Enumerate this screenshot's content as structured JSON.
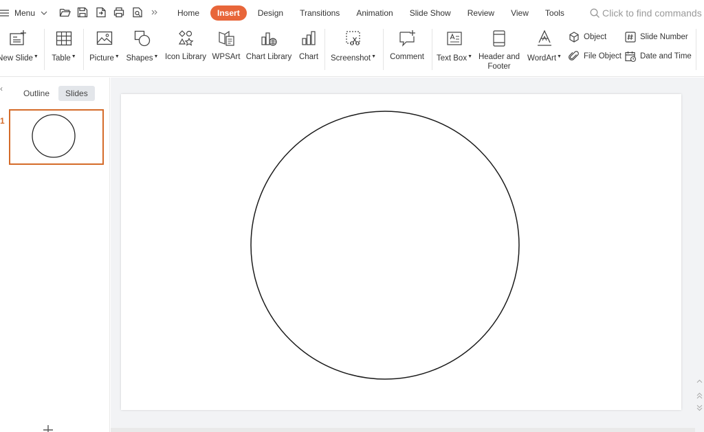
{
  "menu": {
    "label": "Menu"
  },
  "tabs": [
    {
      "label": "Home"
    },
    {
      "label": "Insert",
      "active": true
    },
    {
      "label": "Design"
    },
    {
      "label": "Transitions"
    },
    {
      "label": "Animation"
    },
    {
      "label": "Slide Show"
    },
    {
      "label": "Review"
    },
    {
      "label": "View"
    },
    {
      "label": "Tools"
    }
  ],
  "search": {
    "placeholder": "Click to find commands"
  },
  "ribbon": {
    "new_slide": "New Slide",
    "table": "Table",
    "picture": "Picture",
    "shapes": "Shapes",
    "icon_library": "Icon Library",
    "wpsart": "WPSArt",
    "chart_library": "Chart Library",
    "chart": "Chart",
    "screenshot": "Screenshot",
    "comment": "Comment",
    "text_box": "Text Box",
    "header_footer_1": "Header and",
    "header_footer_2": "Footer",
    "wordart": "WordArt",
    "object": "Object",
    "file_object": "File Object",
    "slide_number": "Slide Number",
    "date_time": "Date and Time"
  },
  "left_panel": {
    "tab_outline": "Outline",
    "tab_slides": "Slides",
    "slide_number": "1"
  },
  "colors": {
    "accent": "#e8663a",
    "selection": "#d46a28"
  }
}
